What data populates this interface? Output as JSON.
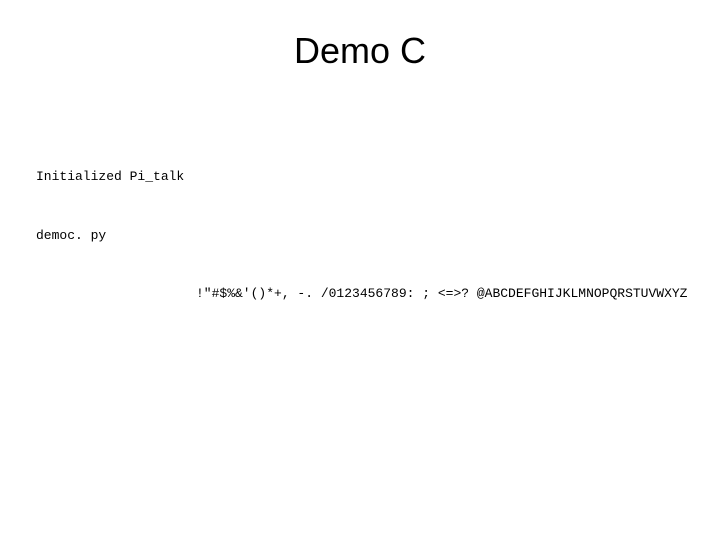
{
  "title": "Demo C",
  "terminal": {
    "line1": "Initialized Pi_talk",
    "line2": "democ. py",
    "line3": "!\"#$%&'()*+, -. /0123456789: ; <=>? @ABCDEFGHIJKLMNOPQRSTUVWXYZ"
  }
}
